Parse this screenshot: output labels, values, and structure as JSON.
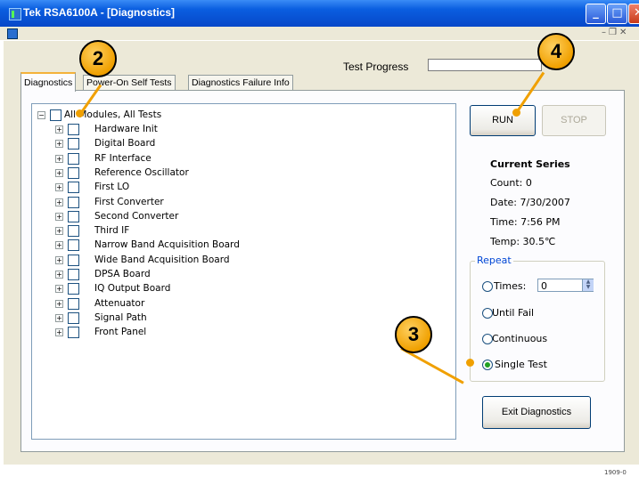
{
  "window": {
    "title": "Tek RSA6100A - [Diagnostics]"
  },
  "progress": {
    "label": "Test Progress"
  },
  "tabs": [
    {
      "label": "Diagnostics"
    },
    {
      "label": "Power-On Self Tests"
    },
    {
      "label": "Diagnostics Failure Info"
    }
  ],
  "tree": {
    "root": "All Modules, All Tests",
    "items": [
      "Hardware Init",
      "Digital Board",
      "RF Interface",
      "Reference Oscillator",
      "First LO",
      "First Converter",
      "Second Converter",
      "Third IF",
      "Narrow Band Acquisition Board",
      "Wide Band Acquisition Board",
      "DPSA Board",
      "IQ Output Board",
      "Attenuator",
      "Signal Path",
      "Front Panel"
    ]
  },
  "buttons": {
    "run": "RUN",
    "stop": "STOP",
    "exit": "Exit Diagnostics"
  },
  "series": {
    "title": "Current Series",
    "count": "Count: 0",
    "date": "Date:  7/30/2007",
    "time": "Time:  7:56 PM",
    "temp": "Temp:  30.5℃"
  },
  "repeat": {
    "legend": "Repeat",
    "times_label": "Times:",
    "times_value": "0",
    "until_fail": "Until Fail",
    "continuous": "Continuous",
    "single_test": "Single Test",
    "selected": "single_test"
  },
  "callouts": [
    "2",
    "3",
    "4"
  ],
  "figure_number": "1909-0"
}
